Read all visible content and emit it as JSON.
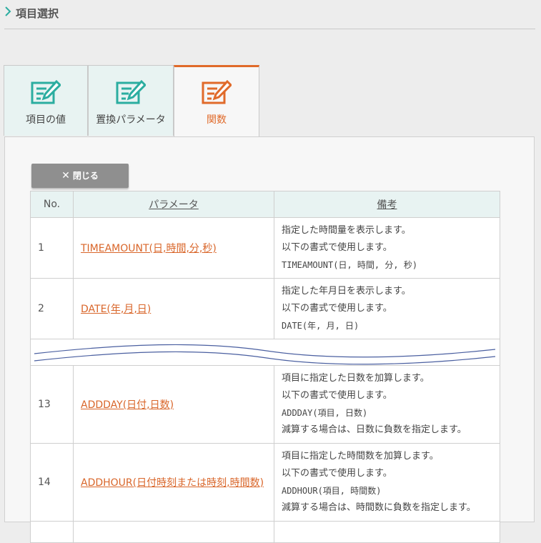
{
  "header": {
    "title": "項目選択"
  },
  "tabs": [
    {
      "label": "項目の値",
      "icon": "edit-form-icon"
    },
    {
      "label": "置換パラメータ",
      "icon": "edit-form-icon"
    },
    {
      "label": "関数",
      "icon": "edit-form-icon"
    }
  ],
  "close_button": {
    "label": "閉じる"
  },
  "table": {
    "headers": {
      "no": "No.",
      "param": "パラメータ",
      "note": "備考"
    },
    "rows": [
      {
        "no": "1",
        "param": "TIMEAMOUNT(日,時間,分,秒)",
        "notes": [
          "指定した時間量を表示します。",
          "以下の書式で使用します。",
          "TIMEAMOUNT(日, 時間, 分, 秒)"
        ]
      },
      {
        "no": "2",
        "param": "DATE(年,月,日)",
        "notes": [
          "指定した年月日を表示します。",
          "以下の書式で使用します。",
          "DATE(年, 月, 日)"
        ]
      },
      {
        "no": "13",
        "param": "ADDDAY(日付,日数)",
        "notes": [
          "項目に指定した日数を加算します。",
          "以下の書式で使用します。",
          "ADDDAY(項目, 日数)",
          "減算する場合は、日数に負数を指定します。"
        ]
      },
      {
        "no": "14",
        "param": "ADDHOUR(日付時刻または時刻,時間数)",
        "notes": [
          "項目に指定した時間数を加算します。",
          "以下の書式で使用します。",
          "ADDHOUR(項目, 時間数)",
          "減算する場合は、時間数に負数を指定します。"
        ]
      }
    ]
  },
  "colors": {
    "accent": "#e06a2a",
    "teal": "#2bada0",
    "tab_bg": "#e8f3f2"
  }
}
